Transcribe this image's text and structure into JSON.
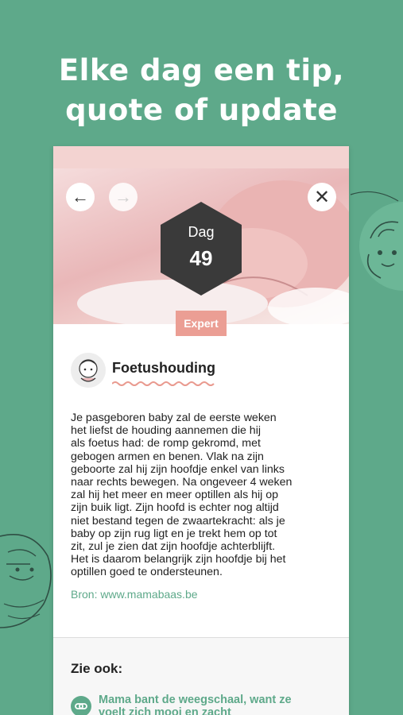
{
  "headline": {
    "line1": "Elke dag een tip,",
    "line2": "quote of update"
  },
  "colors": {
    "background": "#5ea98a",
    "accent_green": "#5ea98a",
    "pink_bar": "#f3d3d1",
    "badge": "#eb9e94",
    "hexagon": "#3a3a3a",
    "wave": "#e99a8f"
  },
  "nav": {
    "back_icon": "arrow-left-icon",
    "forward_icon": "arrow-right-icon",
    "close_icon": "close-icon"
  },
  "day_badge": {
    "label": "Dag",
    "number": "49"
  },
  "category_badge": "Expert",
  "tip": {
    "title": "Foetushouding",
    "body_lines": [
      "Je pasgeboren baby zal de eerste weken",
      "het liefst de houding aannemen die hij",
      "als foetus had: de romp gekromd, met",
      "gebogen armen en benen. Vlak na zijn",
      "geboorte zal hij zijn hoofdje enkel van links",
      "naar rechts bewegen. Na ongeveer 4 weken",
      "zal hij het meer en meer optillen als hij op",
      "zijn buik ligt. Zijn hoofd is echter nog altijd",
      "niet bestand tegen de zwaartekracht: als je",
      "baby op zijn rug ligt en je trekt hem op tot",
      "zit, zul je zien dat zijn hoofdje achterblijft.",
      "Het is daarom belangrijk zijn hoofdje bij het",
      "optillen goed te ondersteunen."
    ],
    "source": "Bron: www.mamabaas.be"
  },
  "see_also": {
    "title": "Zie ook:",
    "link_line1": "Mama bant de weegschaal, want ze",
    "link_line2": "voelt zich mooi en zacht"
  }
}
